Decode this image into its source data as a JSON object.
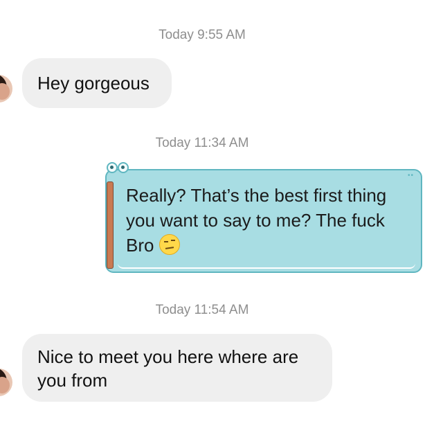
{
  "thread": {
    "messages": [
      {
        "timestamp": "Today 9:55 AM",
        "direction": "incoming",
        "lines": [
          "Hey gorgeous"
        ]
      },
      {
        "timestamp": "Today 11:34 AM",
        "direction": "outgoing",
        "theme": "crocodile",
        "lines": [
          "Really? That’s the best first thing",
          "you want to say to me? The fuck",
          "Bro"
        ],
        "emoji": "raised-eyebrow-face"
      },
      {
        "timestamp": "Today 11:54 AM",
        "direction": "incoming",
        "lines": [
          "Nice to meet you here where are",
          "you from"
        ]
      }
    ]
  },
  "colors": {
    "incoming_bubble": "#efefef",
    "outgoing_bubble": "#a8dde3",
    "outgoing_border": "#5fb6c0",
    "timestamp": "#8e8e8e"
  }
}
